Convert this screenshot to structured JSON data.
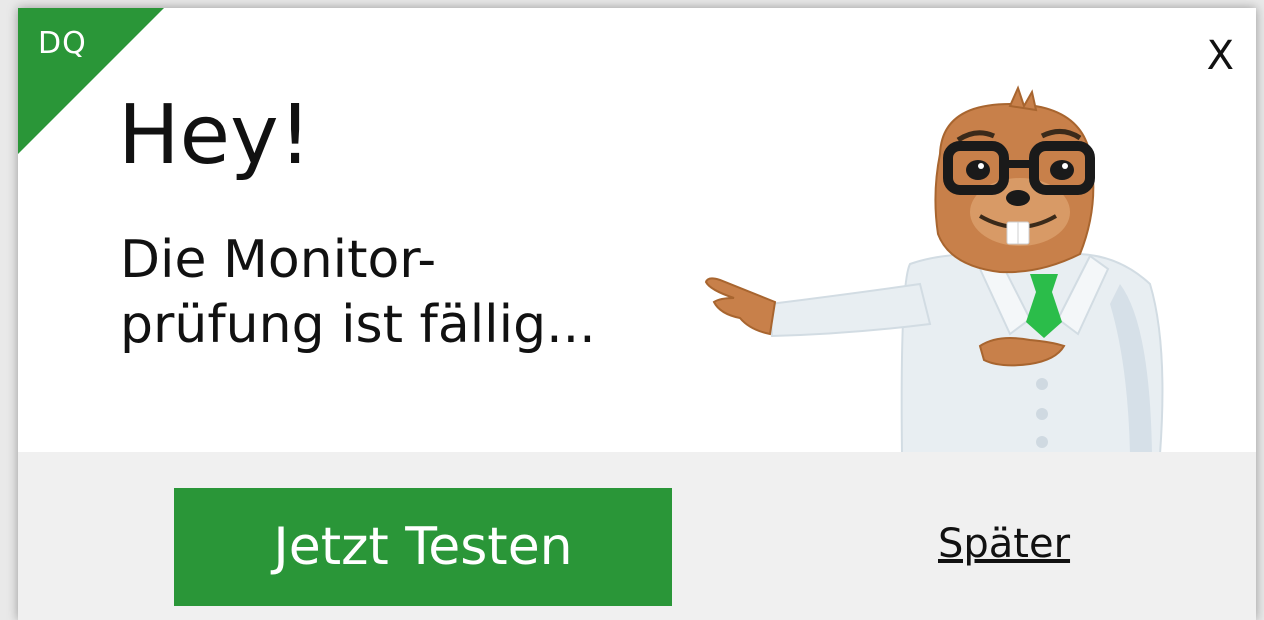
{
  "badge": {
    "label": "DQ",
    "color": "#2a9638"
  },
  "close": {
    "label": "X",
    "icon": "close-icon"
  },
  "headline": "Hey!",
  "message": {
    "line1": "Die Monitor-",
    "line2": "prüfung ist fällig..."
  },
  "mascot": {
    "icon": "groundhog-doctor-mascot"
  },
  "actions": {
    "primary_label": "Jetzt Testen",
    "primary_color": "#2a9638",
    "secondary_label": "Später"
  }
}
